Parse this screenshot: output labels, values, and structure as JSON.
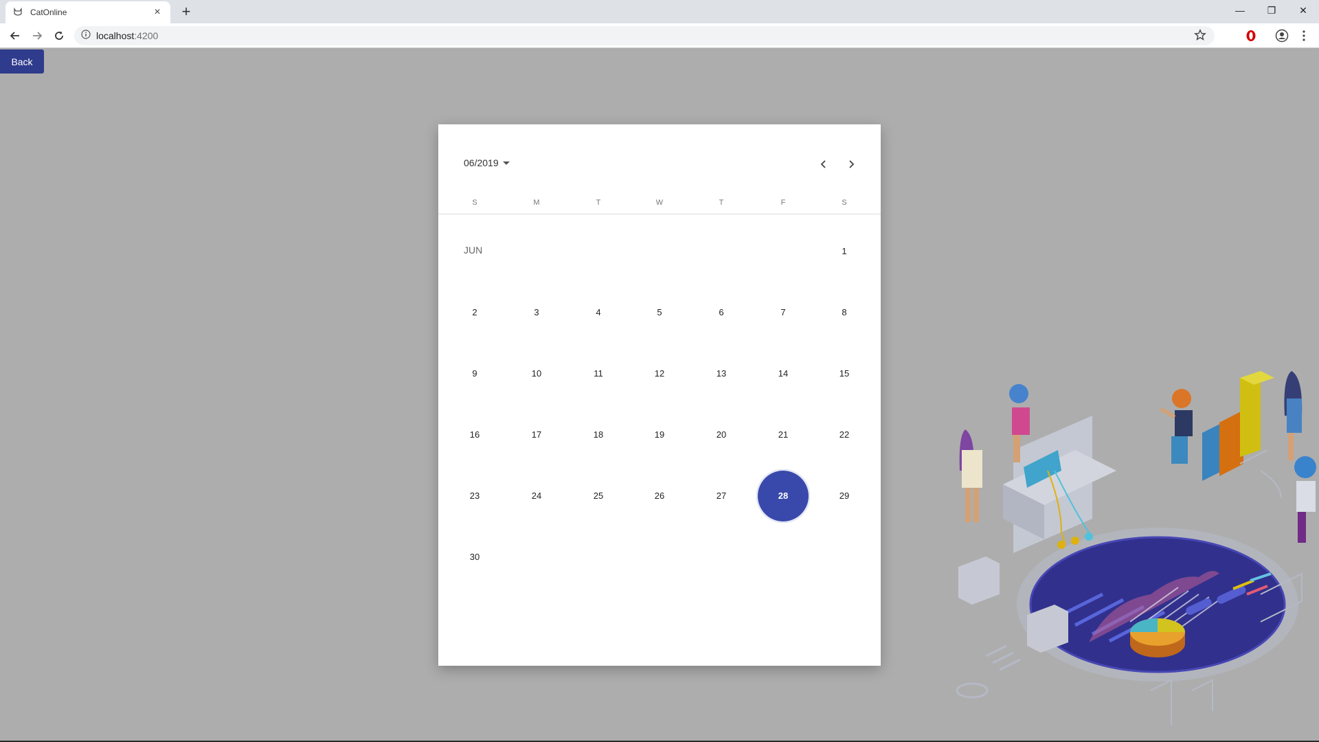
{
  "browser": {
    "tab_title": "CatOnline",
    "tab_close": "×",
    "new_tab": "+",
    "url_host": "localhost",
    "url_port": ":4200",
    "window": {
      "minimize": "—",
      "restore": "❐",
      "close": "✕"
    }
  },
  "page": {
    "back_label": "Back"
  },
  "calendar": {
    "period_label": "06/2019",
    "weekdays": [
      "S",
      "M",
      "T",
      "W",
      "T",
      "F",
      "S"
    ],
    "month_label": "JUN",
    "days": [
      "1",
      "2",
      "3",
      "4",
      "5",
      "6",
      "7",
      "8",
      "9",
      "10",
      "11",
      "12",
      "13",
      "14",
      "15",
      "16",
      "17",
      "18",
      "19",
      "20",
      "21",
      "22",
      "23",
      "24",
      "25",
      "26",
      "27",
      "28",
      "29",
      "30"
    ],
    "selected_day": "28",
    "accent_color": "#3949ab"
  }
}
